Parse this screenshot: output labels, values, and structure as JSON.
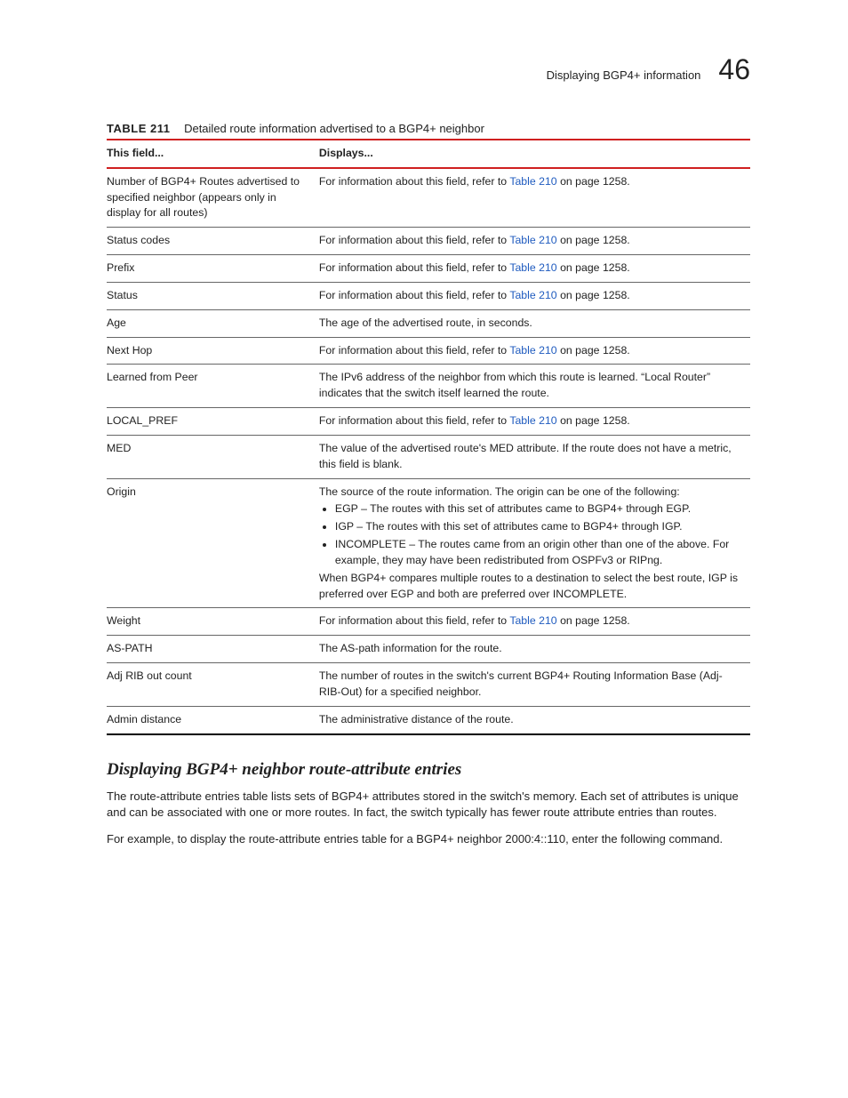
{
  "header": {
    "running": "Displaying BGP4+ information",
    "chapter": "46"
  },
  "table": {
    "label": "TABLE 211",
    "caption": "Detailed route information advertised to a BGP4+ neighbor",
    "head_field": "This field...",
    "head_displays": "Displays...",
    "xref_prefix": "For information about this field, refer to ",
    "xref_link": "Table 210",
    "xref_suffix": " on page 1258.",
    "rows": {
      "r0": {
        "field": "Number of BGP4+ Routes advertised to specified neighbor (appears only in display for all routes)"
      },
      "r1": {
        "field": "Status codes"
      },
      "r2": {
        "field": "Prefix"
      },
      "r3": {
        "field": "Status"
      },
      "r4": {
        "field": "Age",
        "displays": "The age of the advertised route, in seconds."
      },
      "r5": {
        "field": "Next Hop"
      },
      "r6": {
        "field": "Learned from Peer",
        "displays": "The IPv6 address of the neighbor from which this route is learned. “Local Router” indicates that the switch itself learned the route."
      },
      "r7": {
        "field": "LOCAL_PREF"
      },
      "r8": {
        "field": "MED",
        "displays": "The value of the advertised route's MED attribute. If the route does not have a metric, this field is blank."
      },
      "r9": {
        "field": "Origin",
        "intro": "The source of the route information. The origin can be one of the following:",
        "b1": "EGP – The routes with this set of attributes came to BGP4+ through EGP.",
        "b2": "IGP – The routes with this set of attributes came to BGP4+ through IGP.",
        "b3": "INCOMPLETE – The routes came from an origin other than one of the above. For example, they may have been redistributed from OSPFv3 or RIPng.",
        "outro": "When BGP4+ compares multiple routes to a destination to select the best route, IGP is preferred over EGP and both are preferred over INCOMPLETE."
      },
      "r10": {
        "field": "Weight"
      },
      "r11": {
        "field": "AS-PATH",
        "displays": "The AS-path information for the route."
      },
      "r12": {
        "field": "Adj RIB out count",
        "displays": "The number of routes in the switch's current BGP4+ Routing Information Base (Adj-RIB-Out) for a specified neighbor."
      },
      "r13": {
        "field": "Admin distance",
        "displays": "The administrative distance of the route."
      }
    }
  },
  "section": {
    "title": "Displaying BGP4+ neighbor route-attribute entries",
    "p1": "The route-attribute entries table lists sets of BGP4+ attributes stored in the switch's memory. Each set of attributes is unique and can be associated with one or more routes. In fact, the switch typically has fewer route attribute entries than routes.",
    "p2": "For example, to display the route-attribute entries table for a BGP4+ neighbor 2000:4::110, enter the following command."
  }
}
